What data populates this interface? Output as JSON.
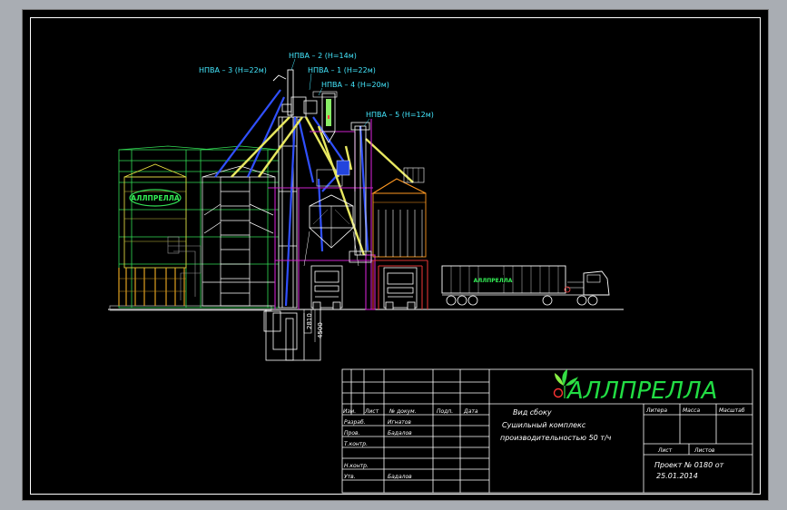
{
  "labels": {
    "npva2": "НПВА – 2   (Н=14м)",
    "npva3": "НПВА – 3   (Н=22м)",
    "npva1": "НПВА – 1   (Н=22м)",
    "npva4": "НПВА – 4   (Н=20м)",
    "npva5": "НПВА – 5   (Н=12м)"
  },
  "dims": {
    "d1": "2810",
    "d2": "4500"
  },
  "silo_brand": "АЛЛПРЕЛЛА",
  "truck_brand": "АЛЛПРЕЛЛА",
  "brand": {
    "name": "АЛЛПРЕЛЛА",
    "color": "#22dd44"
  },
  "title_block": {
    "headers": [
      "Изм.",
      "Лист",
      "№ докум.",
      "Подп.",
      "Дата"
    ],
    "roles": [
      "Разраб.",
      "Пров.",
      "Т.контр.",
      "Н.контр.",
      "Утв."
    ],
    "names": [
      "Игнатов",
      "Бадалов",
      "Бадалов"
    ],
    "description": [
      "Вид сбоку",
      "Сушильный комплекс",
      "производительностью 50 т/ч"
    ],
    "stage_headers": [
      "Литера",
      "Масса",
      "Масштаб"
    ],
    "sheet_headers": [
      "Лист",
      "Листов"
    ],
    "project": [
      "Проект № 0180 от",
      "25.01.2014"
    ]
  }
}
